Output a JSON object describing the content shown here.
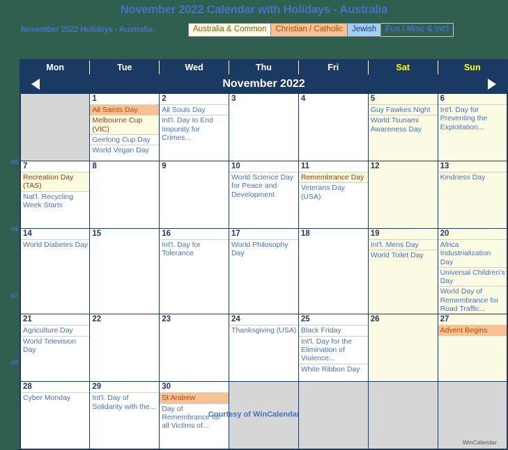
{
  "header": {
    "title": "November 2022 Calendar with Holidays - Australia",
    "legend_label": "November 2022 Holidays - Australia:",
    "legend": [
      {
        "label": "Australia & Common",
        "type": "common",
        "color": "#fffde7"
      },
      {
        "label": "Christian / Catholic",
        "type": "christian",
        "color": "#f8c193"
      },
      {
        "label": "Jewish",
        "type": "jewish",
        "color": "#9fd0f5"
      },
      {
        "label": "Fun / Misc & Int'l",
        "type": "fun",
        "color": "#4472c4"
      }
    ]
  },
  "calendar": {
    "month_title": "November 2022",
    "prev_label": "◀",
    "next_label": "▶",
    "day_headers": [
      {
        "label": "Mon",
        "weekend": false
      },
      {
        "label": "Tue",
        "weekend": false
      },
      {
        "label": "Wed",
        "weekend": false
      },
      {
        "label": "Thu",
        "weekend": false
      },
      {
        "label": "Fri",
        "weekend": false
      },
      {
        "label": "Sat",
        "weekend": true
      },
      {
        "label": "Sun",
        "weekend": true
      }
    ],
    "week_numbers": [
      "",
      "45",
      "46",
      "47",
      "48"
    ],
    "weeks": [
      [
        {
          "day": "",
          "blank": true,
          "weekend": false,
          "events": []
        },
        {
          "day": "1",
          "blank": false,
          "weekend": false,
          "events": [
            {
              "text": "All Saints Day",
              "type": "christian"
            },
            {
              "text": "Melbourne Cup (VIC)",
              "type": "common"
            },
            {
              "text": "Geelong Cup Day",
              "type": "fun"
            },
            {
              "text": "World Vegan Day",
              "type": "fun"
            }
          ]
        },
        {
          "day": "2",
          "blank": false,
          "weekend": false,
          "events": [
            {
              "text": "All Souls Day",
              "type": "fun"
            },
            {
              "text": "Int'l. Day to End Impunity for Crimes...",
              "type": "fun"
            }
          ]
        },
        {
          "day": "3",
          "blank": false,
          "weekend": false,
          "events": []
        },
        {
          "day": "4",
          "blank": false,
          "weekend": false,
          "events": []
        },
        {
          "day": "5",
          "blank": false,
          "weekend": true,
          "events": [
            {
              "text": "Guy Fawkes Night",
              "type": "fun"
            },
            {
              "text": "World Tsunami Awareness Day",
              "type": "fun"
            }
          ]
        },
        {
          "day": "6",
          "blank": false,
          "weekend": true,
          "events": [
            {
              "text": "Int'l. Day for Preventing the Exploitation...",
              "type": "fun"
            }
          ]
        }
      ],
      [
        {
          "day": "7",
          "blank": false,
          "weekend": false,
          "events": [
            {
              "text": "Recreation Day (TAS)",
              "type": "common"
            },
            {
              "text": "Nat'l. Recycling Week Starts",
              "type": "fun"
            }
          ]
        },
        {
          "day": "8",
          "blank": false,
          "weekend": false,
          "events": []
        },
        {
          "day": "9",
          "blank": false,
          "weekend": false,
          "events": []
        },
        {
          "day": "10",
          "blank": false,
          "weekend": false,
          "events": [
            {
              "text": "World Science Day for Peace and Development",
              "type": "fun"
            }
          ]
        },
        {
          "day": "11",
          "blank": false,
          "weekend": false,
          "events": [
            {
              "text": "Remembrance Day",
              "type": "common"
            },
            {
              "text": "Veterans Day (USA)",
              "type": "fun"
            }
          ]
        },
        {
          "day": "12",
          "blank": false,
          "weekend": true,
          "events": []
        },
        {
          "day": "13",
          "blank": false,
          "weekend": true,
          "events": [
            {
              "text": "Kindness Day",
              "type": "fun"
            }
          ]
        }
      ],
      [
        {
          "day": "14",
          "blank": false,
          "weekend": false,
          "events": [
            {
              "text": "World Diabetes Day",
              "type": "fun"
            }
          ]
        },
        {
          "day": "15",
          "blank": false,
          "weekend": false,
          "events": []
        },
        {
          "day": "16",
          "blank": false,
          "weekend": false,
          "events": [
            {
              "text": "Int'l. Day for Tolerance",
              "type": "fun"
            }
          ]
        },
        {
          "day": "17",
          "blank": false,
          "weekend": false,
          "events": [
            {
              "text": "World Philosophy Day",
              "type": "fun"
            }
          ]
        },
        {
          "day": "18",
          "blank": false,
          "weekend": false,
          "events": []
        },
        {
          "day": "19",
          "blank": false,
          "weekend": true,
          "events": [
            {
              "text": "Int'l. Mens Day",
              "type": "fun"
            },
            {
              "text": "World Toilet Day",
              "type": "fun"
            }
          ]
        },
        {
          "day": "20",
          "blank": false,
          "weekend": true,
          "events": [
            {
              "text": "Africa Industrialization Day",
              "type": "fun"
            },
            {
              "text": "Universal Children's Day",
              "type": "fun"
            },
            {
              "text": "World Day of Remembrance for Road Traffic...",
              "type": "fun"
            }
          ]
        }
      ],
      [
        {
          "day": "21",
          "blank": false,
          "weekend": false,
          "events": [
            {
              "text": "Agriculture Day",
              "type": "fun"
            },
            {
              "text": "World Television Day",
              "type": "fun"
            }
          ]
        },
        {
          "day": "22",
          "blank": false,
          "weekend": false,
          "events": []
        },
        {
          "day": "23",
          "blank": false,
          "weekend": false,
          "events": []
        },
        {
          "day": "24",
          "blank": false,
          "weekend": false,
          "events": [
            {
              "text": "Thanksgiving (USA)",
              "type": "fun"
            }
          ]
        },
        {
          "day": "25",
          "blank": false,
          "weekend": false,
          "events": [
            {
              "text": "Black Friday",
              "type": "fun"
            },
            {
              "text": "Int'l. Day for the Elimination of Violence...",
              "type": "fun"
            },
            {
              "text": "White Ribbon Day",
              "type": "fun"
            }
          ]
        },
        {
          "day": "26",
          "blank": false,
          "weekend": true,
          "events": []
        },
        {
          "day": "27",
          "blank": false,
          "weekend": true,
          "events": [
            {
              "text": "Advent Begins",
              "type": "christian"
            }
          ]
        }
      ],
      [
        {
          "day": "28",
          "blank": false,
          "weekend": false,
          "events": [
            {
              "text": "Cyber Monday",
              "type": "fun"
            }
          ]
        },
        {
          "day": "29",
          "blank": false,
          "weekend": false,
          "events": [
            {
              "text": "Int'l. Day of Solidarity with the...",
              "type": "fun"
            }
          ]
        },
        {
          "day": "30",
          "blank": false,
          "weekend": false,
          "events": [
            {
              "text": "St Andrew",
              "type": "christian"
            },
            {
              "text": "Day of Remembrance for all Victims of...",
              "type": "fun"
            }
          ]
        },
        {
          "day": "",
          "blank": true,
          "pad": true,
          "weekend": false,
          "events": []
        },
        {
          "day": "",
          "blank": true,
          "pad": true,
          "weekend": false,
          "events": []
        },
        {
          "day": "",
          "blank": true,
          "pad": true,
          "weekend": false,
          "events": []
        },
        {
          "day": "",
          "blank": true,
          "pad": true,
          "weekend": false,
          "events": []
        }
      ]
    ],
    "watermark": "WinCalendar"
  },
  "footer": {
    "text_prefix": "Courtesy of ",
    "brand": "WinCalendar"
  }
}
